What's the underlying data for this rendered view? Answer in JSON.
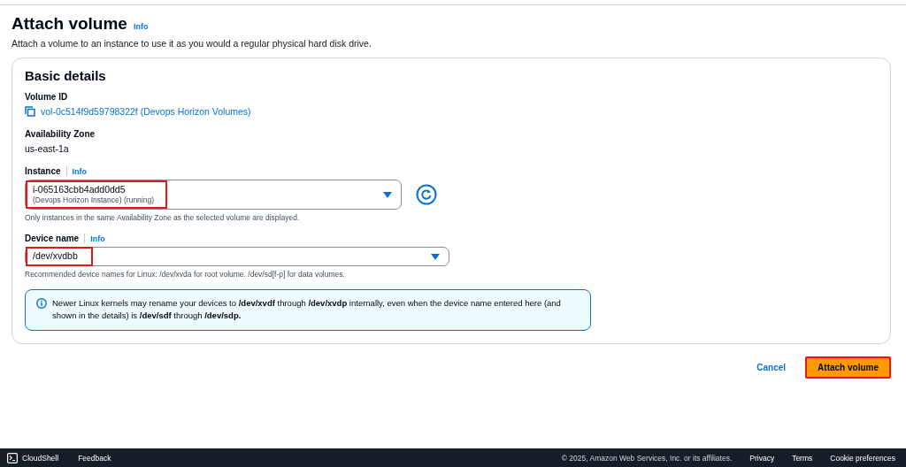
{
  "header": {
    "title": "Attach volume",
    "info": "Info",
    "description": "Attach a volume to an instance to use it as you would a regular physical hard disk drive."
  },
  "section": {
    "title": "Basic details",
    "volume_id": {
      "label": "Volume ID",
      "value": "vol-0c514f9d59798322f (Devops Horizon Volumes)"
    },
    "availability_zone": {
      "label": "Availability Zone",
      "value": "us-east-1a"
    },
    "instance": {
      "label": "Instance",
      "info": "Info",
      "value": "i-065163cbb4add0dd5",
      "secondary": "(Devops Horizon Instance) (running)",
      "highlighted": true,
      "hint": "Only instances in the same Availability Zone as the selected volume are displayed."
    },
    "device_name": {
      "label": "Device name",
      "info": "Info",
      "value": "/dev/xvdbb",
      "highlighted": true,
      "hint": "Recommended device names for Linux: /dev/xvda for root volume. /dev/sd[f-p] for data volumes."
    },
    "alert": "Newer Linux kernels may rename your devices to **/dev/xvdf** through **/dev/xvdp** internally, even when the device name entered here (and shown in the details) is **/dev/sdf** through **/dev/sdp.**"
  },
  "actions": {
    "cancel": "Cancel",
    "submit": "Attach volume",
    "submit_highlighted": true
  },
  "footer": {
    "left": [
      "CloudShell",
      "Feedback"
    ],
    "copyright": "© 2025, Amazon Web Services, Inc. or its affiliates.",
    "links": [
      "Privacy",
      "Terms",
      "Cookie preferences"
    ]
  }
}
